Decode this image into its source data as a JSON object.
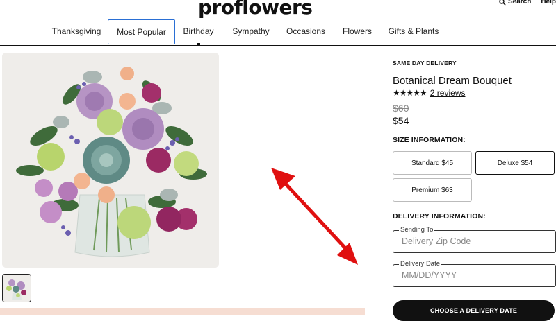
{
  "header": {
    "logo": "proflowers",
    "search_label": "Search",
    "help_label": "Help"
  },
  "nav": {
    "items": [
      {
        "label": "Thanksgiving"
      },
      {
        "label": "Most Popular"
      },
      {
        "label": "Birthday"
      },
      {
        "label": "Sympathy"
      },
      {
        "label": "Occasions"
      },
      {
        "label": "Flowers"
      },
      {
        "label": "Gifts & Plants"
      }
    ],
    "active": "Most Popular"
  },
  "product": {
    "eyebrow": "SAME DAY DELIVERY",
    "title": "Botanical Dream Bouquet",
    "stars": "★★★★★",
    "rating_value": 5,
    "reviews_label": "2 reviews",
    "old_price": "$60",
    "price": "$54"
  },
  "size": {
    "label": "SIZE INFORMATION:",
    "options": [
      {
        "label": "Standard $45"
      },
      {
        "label": "Deluxe $54"
      },
      {
        "label": "Premium $63"
      }
    ],
    "selected": "Deluxe $54"
  },
  "delivery": {
    "label": "DELIVERY INFORMATION:",
    "zip": {
      "label": "Sending To",
      "placeholder": "Delivery Zip Code"
    },
    "date": {
      "label": "Delivery Date",
      "placeholder": "MM/DD/YYYY"
    },
    "cta_label": "CHOOSE A DELIVERY DATE"
  },
  "colors": {
    "accent_nav_border": "#2a6fd4",
    "cta_background": "#111111",
    "promo_band": "#f6ddd2",
    "annotation_arrow": "#e01010"
  },
  "icons": [
    "search-icon",
    "star-icon",
    "annotation-arrow"
  ]
}
